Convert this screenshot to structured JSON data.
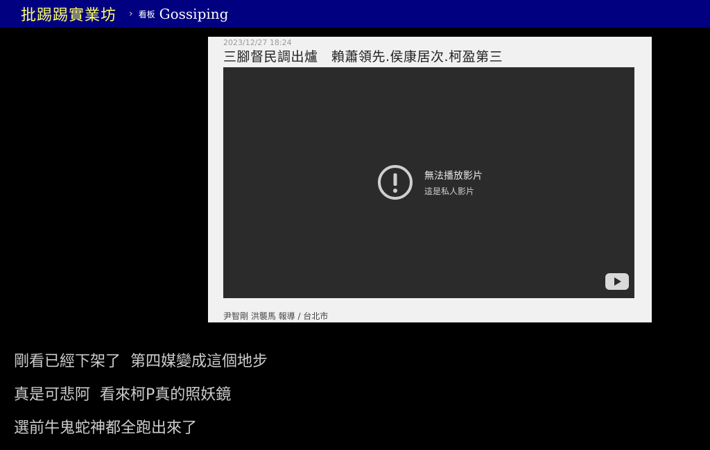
{
  "header": {
    "site_title": "批踢踢實業坊",
    "separator": "›",
    "board_label": "看板",
    "board_name": "Gossiping"
  },
  "embed": {
    "date": "2023/12/27 18:24",
    "headline": "三腳督民調出爐　賴蕭領先.侯康居次.柯盈第三",
    "video_error_title": "無法播放影片",
    "video_error_subtitle": "這是私人影片",
    "credit": "尹智剛 洪襲馬 報導 / 台北市"
  },
  "post": {
    "lines": [
      "剛看已經下架了  第四媒變成這個地步",
      "真是可悲阿  看來柯P真的照妖鏡",
      "選前牛鬼蛇神都全跑出來了"
    ]
  },
  "colors": {
    "header_bg": "#000080",
    "site_title": "#ffff66",
    "page_bg": "#000000",
    "post_text": "#cccccc"
  }
}
